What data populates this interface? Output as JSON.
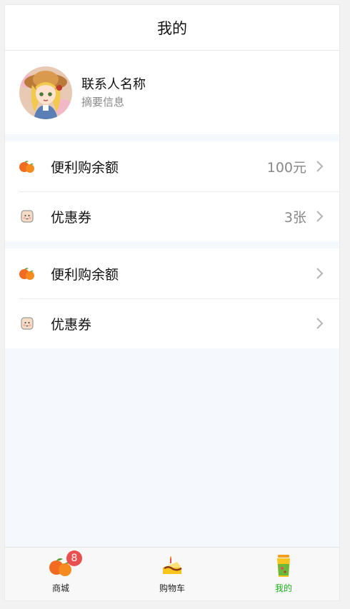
{
  "header": {
    "title": "我的"
  },
  "profile": {
    "name": "联系人名称",
    "summary": "摘要信息"
  },
  "groups": [
    {
      "items": [
        {
          "label": "便利购余额",
          "value": "100元",
          "icon": "tangerine-icon"
        },
        {
          "label": "优惠券",
          "value": "3张",
          "icon": "coupon-face-icon"
        }
      ]
    },
    {
      "items": [
        {
          "label": "便利购余额",
          "value": "",
          "icon": "tangerine-icon"
        },
        {
          "label": "优惠券",
          "value": "",
          "icon": "coupon-face-icon"
        }
      ]
    }
  ],
  "tabbar": {
    "tabs": [
      {
        "label": "商城",
        "icon": "tangerines-icon",
        "badge": "8",
        "active": false
      },
      {
        "label": "购物车",
        "icon": "cake-icon",
        "badge": "",
        "active": false
      },
      {
        "label": "我的",
        "icon": "drink-cup-icon",
        "badge": "",
        "active": true
      }
    ],
    "active_color": "#1aad19",
    "badge_color": "#e94f4f"
  }
}
